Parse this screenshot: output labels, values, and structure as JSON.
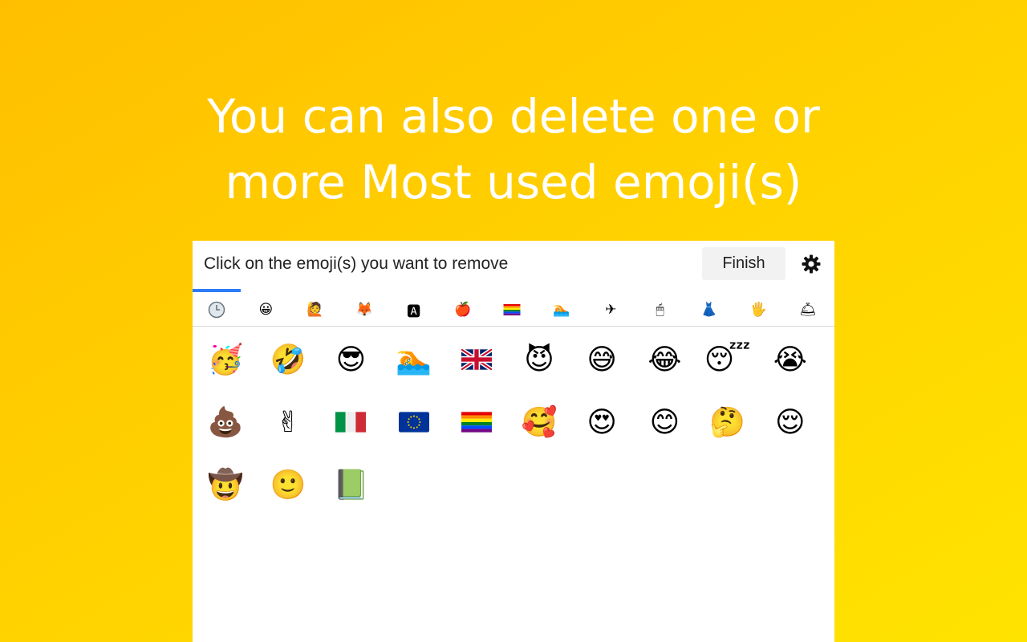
{
  "headline": {
    "line1": "You can also delete one or",
    "line2": "more Most used emoji(s)"
  },
  "panel": {
    "instruction": "Click on the emoji(s) you want to remove",
    "finish_label": "Finish",
    "settings_icon": "gear-icon"
  },
  "tabs": [
    {
      "name": "recent",
      "icon": "clock-icon",
      "glyph": "🕒"
    },
    {
      "name": "smileys",
      "icon": "smiley-icon",
      "glyph": "😀"
    },
    {
      "name": "people",
      "icon": "person-icon",
      "glyph": "🙋"
    },
    {
      "name": "animals",
      "icon": "fox-icon",
      "glyph": "🦊"
    },
    {
      "name": "symbols",
      "icon": "letter-a-icon",
      "glyph": "🅰"
    },
    {
      "name": "food",
      "icon": "apple-icon",
      "glyph": "🍎"
    },
    {
      "name": "flags",
      "icon": "rainbow-flag-icon",
      "glyph": ""
    },
    {
      "name": "activities",
      "icon": "swimmer-icon",
      "glyph": "🏊"
    },
    {
      "name": "travel",
      "icon": "airplane-icon",
      "glyph": "✈"
    },
    {
      "name": "objects",
      "icon": "mouse-icon",
      "glyph": "🖱"
    },
    {
      "name": "clothing",
      "icon": "dress-icon",
      "glyph": "👗"
    },
    {
      "name": "hands",
      "icon": "raised-hand-icon",
      "glyph": "🖐"
    },
    {
      "name": "misc",
      "icon": "bell-icon",
      "glyph": "🛎"
    }
  ],
  "emojis": [
    {
      "name": "partying-face",
      "glyph": "🥳"
    },
    {
      "name": "rolling-on-floor-laughing",
      "glyph": "🤣"
    },
    {
      "name": "smiling-face-with-sunglasses",
      "glyph": "😎"
    },
    {
      "name": "person-swimming",
      "glyph": "🏊"
    },
    {
      "name": "flag-united-kingdom",
      "glyph": "",
      "flag": "uk"
    },
    {
      "name": "smiling-face-with-horns",
      "glyph": "😈"
    },
    {
      "name": "grinning-face-with-sweat",
      "glyph": "😅"
    },
    {
      "name": "face-with-tears-of-joy",
      "glyph": "😂"
    },
    {
      "name": "sleeping-face",
      "glyph": "😴"
    },
    {
      "name": "loudly-crying-face",
      "glyph": "😭"
    },
    {
      "name": "pile-of-poo",
      "glyph": "💩"
    },
    {
      "name": "victory-hand",
      "glyph": "✌"
    },
    {
      "name": "flag-italy",
      "glyph": "",
      "flag": "it"
    },
    {
      "name": "flag-european-union",
      "glyph": "",
      "flag": "eu"
    },
    {
      "name": "rainbow-flag",
      "glyph": "",
      "flag": "rainbow"
    },
    {
      "name": "smiling-face-with-hearts",
      "glyph": "🥰"
    },
    {
      "name": "smiling-face-with-heart-eyes",
      "glyph": "😍"
    },
    {
      "name": "smiling-face-with-smiling-eyes",
      "glyph": "😊"
    },
    {
      "name": "thinking-face",
      "glyph": "🤔"
    },
    {
      "name": "relieved-face",
      "glyph": "😌"
    },
    {
      "name": "cowboy-hat-face",
      "glyph": "🤠"
    },
    {
      "name": "slightly-smiling-face",
      "glyph": "🙂"
    },
    {
      "name": "green-book",
      "glyph": "📗"
    }
  ],
  "colors": {
    "background_start": "#ffbf00",
    "background_end": "#ffe300",
    "tab_indicator": "#2b7cf6",
    "finish_button_bg": "#f2f2f2"
  }
}
